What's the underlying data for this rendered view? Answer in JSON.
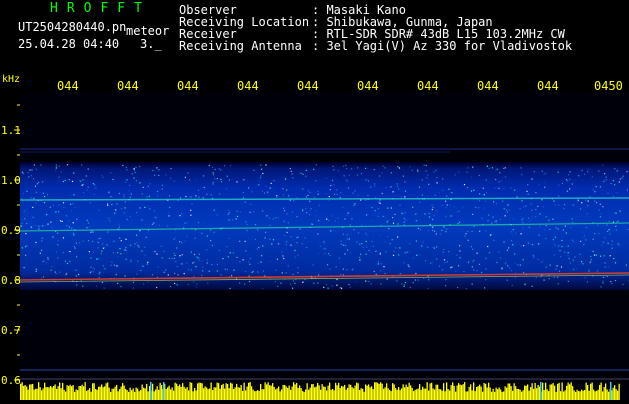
{
  "header": {
    "app_title": "HROFFT",
    "file_name": "UT2504280440.pn",
    "file_tag": "meteor",
    "date_time": "25.04.28 04:40",
    "count": "3._",
    "info": [
      {
        "label": "Observer",
        "value": ": Masaki Kano"
      },
      {
        "label": "Receiving Location",
        "value": ": Shibukawa, Gunma, Japan"
      },
      {
        "label": "Receiver",
        "value": ": RTL-SDR SDR# 43dB L15 103.2MHz CW"
      },
      {
        "label": "Receiving Antenna",
        "value": ": 3el Yagi(V) Az 330 for Vladivostok"
      }
    ]
  },
  "axes": {
    "unit": "kHz",
    "time_ticks": [
      "044",
      "044",
      "044",
      "044",
      "044",
      "044",
      "044",
      "044",
      "044",
      "0450"
    ],
    "freq_ticks": [
      "1.1",
      "1.0",
      "0.9",
      "0.8",
      "0.7",
      "0.6"
    ]
  },
  "colors": {
    "label": "#ffff00",
    "title": "#00ff00",
    "background": "#000000"
  }
}
